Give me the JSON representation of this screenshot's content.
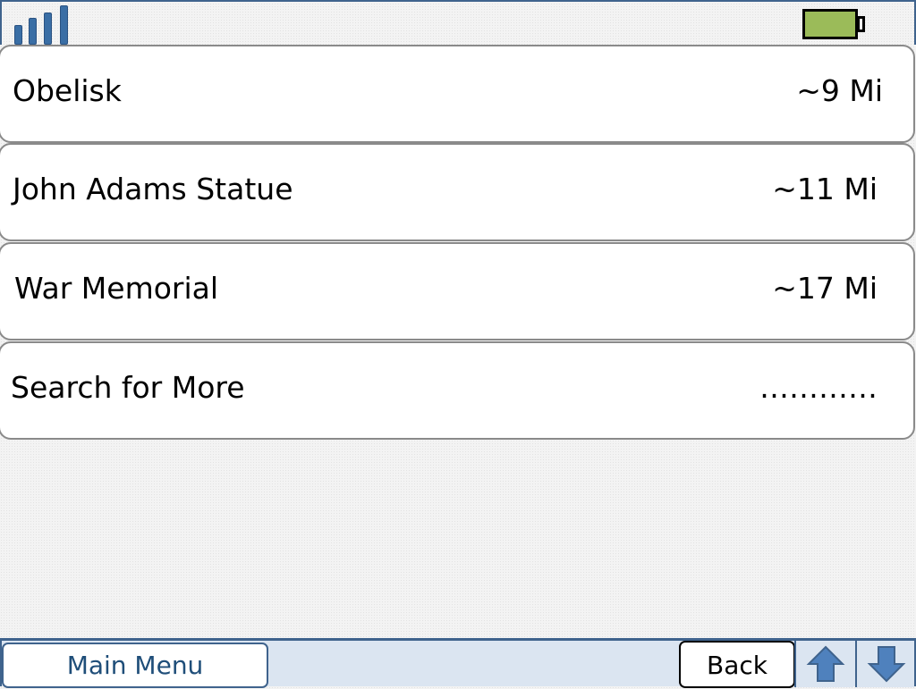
{
  "status_bar": {
    "signal_icon": "signal-strength-icon",
    "battery_icon": "battery-icon",
    "battery_color": "#9bbb59",
    "accent_color": "#3f638d"
  },
  "locations": [
    {
      "name": "Obelisk",
      "distance": "~9 Mi"
    },
    {
      "name": "John Adams Statue",
      "distance": "~11 Mi"
    },
    {
      "name": "War Memorial",
      "distance": "~17 Mi"
    },
    {
      "name": "Search for More",
      "distance": "…………"
    }
  ],
  "bottom_bar": {
    "main_menu_label": "Main Menu",
    "back_label": "Back",
    "up_icon": "arrow-up-icon",
    "down_icon": "arrow-down-icon"
  }
}
